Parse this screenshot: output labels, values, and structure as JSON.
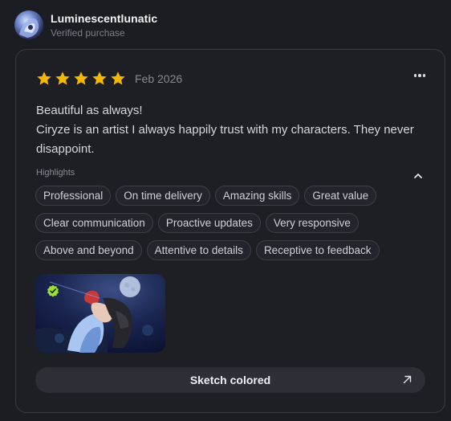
{
  "reviewer": {
    "name": "Luminescentlunatic",
    "status": "Verified purchase"
  },
  "review": {
    "rating": 5,
    "rating_max": 5,
    "date": "Feb 2026",
    "lines": [
      "Beautiful as always!",
      "Ciryze is an artist I always happily trust with my characters. They never disappoint."
    ]
  },
  "highlights": {
    "label": "Highlights",
    "tags": [
      "Professional",
      "On time delivery",
      "Amazing skills",
      "Great value",
      "Clear communication",
      "Proactive updates",
      "Very responsive",
      "Above and beyond",
      "Attentive to details",
      "Receptive to feedback"
    ]
  },
  "product": {
    "label": "Sketch colored"
  },
  "colors": {
    "star": "#f5b800",
    "verified_badge": "#9be22d",
    "background": "#1c1c23"
  },
  "icons": {
    "more": "more-options-icon",
    "collapse": "chevron-up-icon",
    "external": "arrow-up-right-icon",
    "badge": "verified-badge-icon"
  }
}
